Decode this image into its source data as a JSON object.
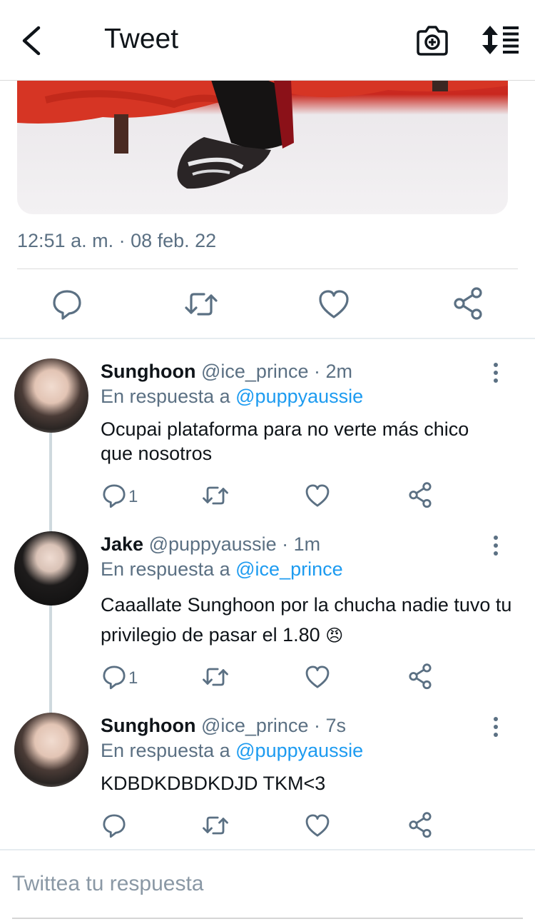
{
  "header": {
    "title": "Tweet",
    "back_icon": "chevron-left-icon",
    "camera_icon": "camera-add-icon",
    "sort_icon": "sort-list-icon"
  },
  "tweet": {
    "timestamp": "12:51 a. m. · 08 feb. 22",
    "media_alt": "photo"
  },
  "replies": [
    {
      "name": "Sunghoon",
      "handle": "@ice_prince",
      "time": "2m",
      "reply_to_prefix": "En respuesta a",
      "reply_to": "@puppyaussie",
      "text": "Ocupai plataforma para no verte más chico que nosotros",
      "reply_count": "1"
    },
    {
      "name": "Jake",
      "handle": "@puppyaussie",
      "time": "1m",
      "reply_to_prefix": "En respuesta a",
      "reply_to": "@ice_prince",
      "text": "Caaallate Sunghoon por la chucha nadie tuvo tu privilegio de pasar el 1.80",
      "emoji": "😠",
      "reply_count": "1"
    },
    {
      "name": "Sunghoon",
      "handle": "@ice_prince",
      "time": "7s",
      "reply_to_prefix": "En respuesta a",
      "reply_to": "@puppyaussie",
      "text": "KDBDKDBDKDJD TKM<3",
      "reply_count": ""
    }
  ],
  "composer": {
    "placeholder": "Twittea tu respuesta"
  },
  "colors": {
    "accent": "#1d9bf0",
    "secondary_text": "#5b7083"
  }
}
